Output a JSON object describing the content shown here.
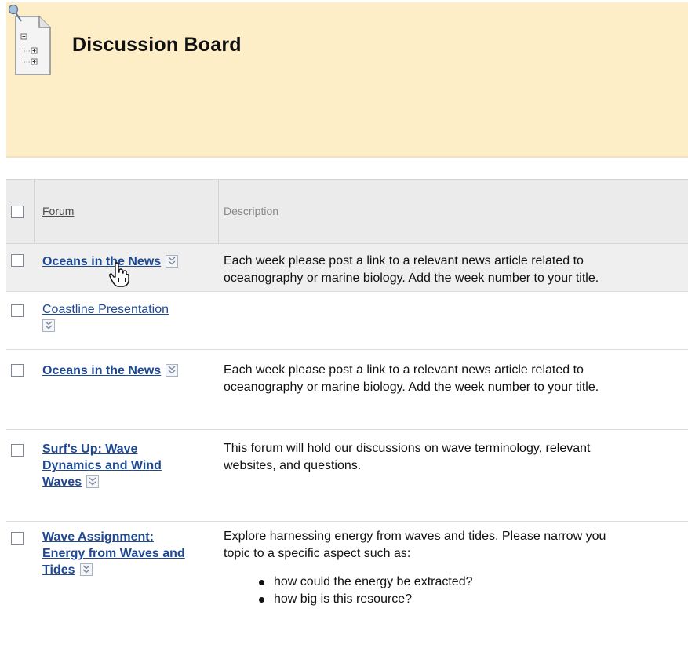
{
  "header": {
    "title": "Discussion Board",
    "icon": "document-tree-icon"
  },
  "table": {
    "columns": {
      "forum": "Forum",
      "description": "Description"
    },
    "rows": [
      {
        "forum_lines": [
          "Oceans in the News"
        ],
        "bold": true,
        "description": [
          "Each week please post a link to a relevant news article related to",
          "oceanography or marine biology. Add the week number to your title."
        ]
      },
      {
        "forum_lines": [
          "Coastline Presentation"
        ],
        "bold": false,
        "description": []
      },
      {
        "forum_lines": [
          "Oceans in the News"
        ],
        "bold": true,
        "description": [
          "Each week please post a link to a relevant news article related to",
          "oceanography or marine biology. Add the week number to your title."
        ]
      },
      {
        "forum_lines": [
          "Surf's Up: Wave",
          "Dynamics and Wind",
          "Waves"
        ],
        "bold": true,
        "description": [
          "This forum will hold our discussions on wave terminology, relevant",
          "websites, and questions."
        ]
      },
      {
        "forum_lines": [
          "Wave Assignment:",
          "Energy from Waves and",
          "Tides"
        ],
        "bold": true,
        "description": [
          "Explore harnessing energy from waves and tides. Please narrow you",
          "topic to a specific aspect such as:"
        ],
        "bullets": [
          "how could the energy be extracted?",
          "how big is this resource?"
        ]
      }
    ]
  },
  "colors": {
    "header_bg": "#fdeec8",
    "link": "#1f4a93",
    "grid_header_bg": "#ebebeb"
  }
}
